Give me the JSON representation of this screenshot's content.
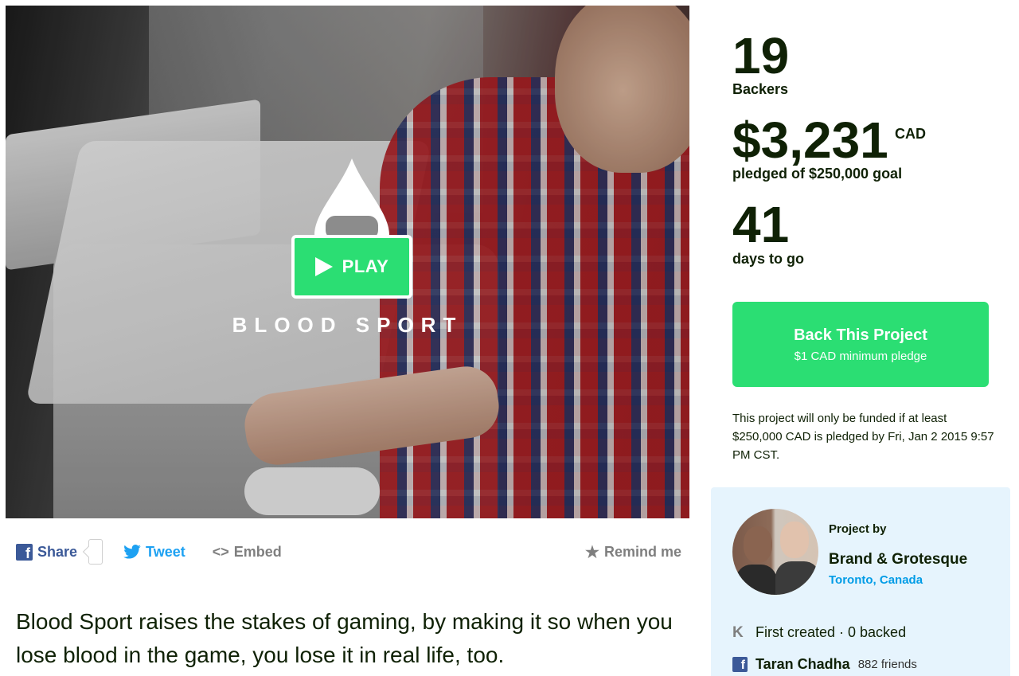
{
  "video": {
    "title": "BLOOD SPORT",
    "play_label": "PLAY"
  },
  "share": {
    "facebook_label": "Share",
    "twitter_label": "Tweet",
    "embed_label": "Embed",
    "remind_label": "Remind me"
  },
  "blurb": "Blood Sport raises the stakes of gaming, by making it so when you lose blood in the game, you lose it in real life, too.",
  "stats": {
    "backers_count": "19",
    "backers_label": "Backers",
    "pledged_amount": "$3,231",
    "pledged_currency": "CAD",
    "pledged_label": "pledged of $250,000 goal",
    "days_count": "41",
    "days_label": "days to go"
  },
  "back_button": {
    "title": "Back This Project",
    "subtitle": "$1 CAD minimum pledge"
  },
  "funding_note": "This project will only be funded if at least $250,000 CAD is pledged by Fri, Jan 2 2015 9:57 PM CST.",
  "creator": {
    "project_by_label": "Project by",
    "name": "Brand & Grotesque",
    "location": "Toronto, Canada",
    "kickstarter_summary": "First created · 0 backed",
    "facebook_name": "Taran Chadha",
    "facebook_friends": "882 friends"
  },
  "colors": {
    "accent_green": "#2bde73",
    "text_dark": "#0f2105",
    "facebook_blue": "#3b5998",
    "twitter_blue": "#1da1f2",
    "link_blue": "#009ce6",
    "creator_card_bg": "#e6f4fd"
  },
  "icons": [
    "play-icon",
    "facebook-icon",
    "twitter-icon",
    "embed-icon",
    "star-icon",
    "kickstarter-icon",
    "blood-drop-logo-icon"
  ]
}
